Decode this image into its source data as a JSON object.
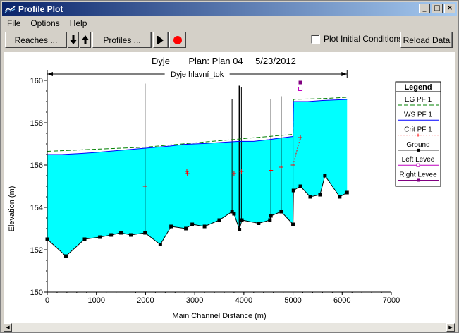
{
  "window": {
    "title": "Profile Plot",
    "buttons": {
      "minimize": "_",
      "maximize": "□",
      "close": "×"
    }
  },
  "menu": [
    "File",
    "Options",
    "Help"
  ],
  "toolbar": {
    "reaches_label": "Reaches ...",
    "profiles_label": "Profiles ...",
    "plot_initial_label": "Plot Initial Conditions",
    "plot_initial_checked": false,
    "reload_label": "Reload Data"
  },
  "chart_data": {
    "type": "line",
    "title_parts": [
      "Dyje",
      "Plan: Plan 04",
      "5/23/2012"
    ],
    "reach_label": "Dyje hlavní_tok",
    "xlabel": "Main Channel Distance (m)",
    "ylabel": "Elevation (m)",
    "xlim": [
      0,
      7000
    ],
    "ylim": [
      150,
      160
    ],
    "xticks": [
      0,
      1000,
      2000,
      3000,
      4000,
      5000,
      6000,
      7000
    ],
    "yticks": [
      150,
      152,
      154,
      156,
      158,
      160
    ],
    "reach_extent": [
      0,
      6100
    ],
    "series": [
      {
        "name": "EG  PF 1",
        "color": "#008000",
        "style": "dashed",
        "x": [
          0,
          2000,
          4000,
          5000,
          5010,
          5700,
          6100
        ],
        "y": [
          156.65,
          156.85,
          157.25,
          157.45,
          159.1,
          159.15,
          159.2
        ]
      },
      {
        "name": "WS  PF 1",
        "color": "#0000ff",
        "style": "solid",
        "x": [
          0,
          300,
          700,
          1000,
          1500,
          2000,
          2500,
          2800,
          3200,
          3600,
          3900,
          4200,
          4500,
          4750,
          5000,
          5010,
          5300,
          5600,
          6100
        ],
        "y": [
          156.5,
          156.5,
          156.55,
          156.6,
          156.7,
          156.8,
          156.9,
          156.98,
          157.02,
          157.08,
          157.12,
          157.12,
          157.2,
          157.28,
          157.35,
          159.0,
          159.0,
          159.05,
          159.1
        ]
      },
      {
        "name": "Crit  PF 1",
        "color": "#ff0000",
        "style": "dashed",
        "x": [
          1990,
          2840,
          2850,
          3800,
          3950,
          4550,
          4760,
          5000,
          5150
        ],
        "y": [
          155.0,
          155.7,
          155.6,
          155.6,
          155.7,
          155.75,
          155.9,
          156.0,
          157.3
        ]
      },
      {
        "name": "Ground",
        "color": "#000000",
        "style": "solid",
        "x": [
          0,
          380,
          760,
          1070,
          1300,
          1500,
          1700,
          1990,
          2300,
          2520,
          2820,
          2950,
          3200,
          3500,
          3760,
          3800,
          3910,
          3960,
          4300,
          4530,
          4550,
          4760,
          5000,
          5010,
          5150,
          5350,
          5550,
          5650,
          5950,
          6100
        ],
        "y": [
          152.5,
          151.7,
          152.5,
          152.6,
          152.7,
          152.8,
          152.7,
          152.8,
          152.25,
          153.1,
          153.0,
          153.2,
          153.1,
          153.4,
          153.8,
          153.7,
          152.95,
          153.4,
          153.25,
          153.4,
          153.6,
          153.8,
          153.2,
          154.8,
          155.0,
          154.5,
          154.6,
          155.5,
          154.5,
          154.7
        ]
      },
      {
        "name": "Left Levee",
        "color": "#c000c0",
        "style": "solid",
        "x": [
          5150
        ],
        "y": [
          159.6
        ]
      },
      {
        "name": "Right Levee",
        "color": "#800080",
        "style": "solid",
        "x": [
          5150
        ],
        "y": [
          159.9
        ]
      }
    ],
    "pier_lines_x": [
      1990,
      3760,
      3910,
      3950,
      4550,
      4760,
      5000
    ],
    "pier_tops_y": [
      159.85,
      159.1,
      159.75,
      159.7,
      159.1,
      159.25,
      157.4
    ],
    "legend_title": "Legend",
    "legend_placement": "right"
  }
}
